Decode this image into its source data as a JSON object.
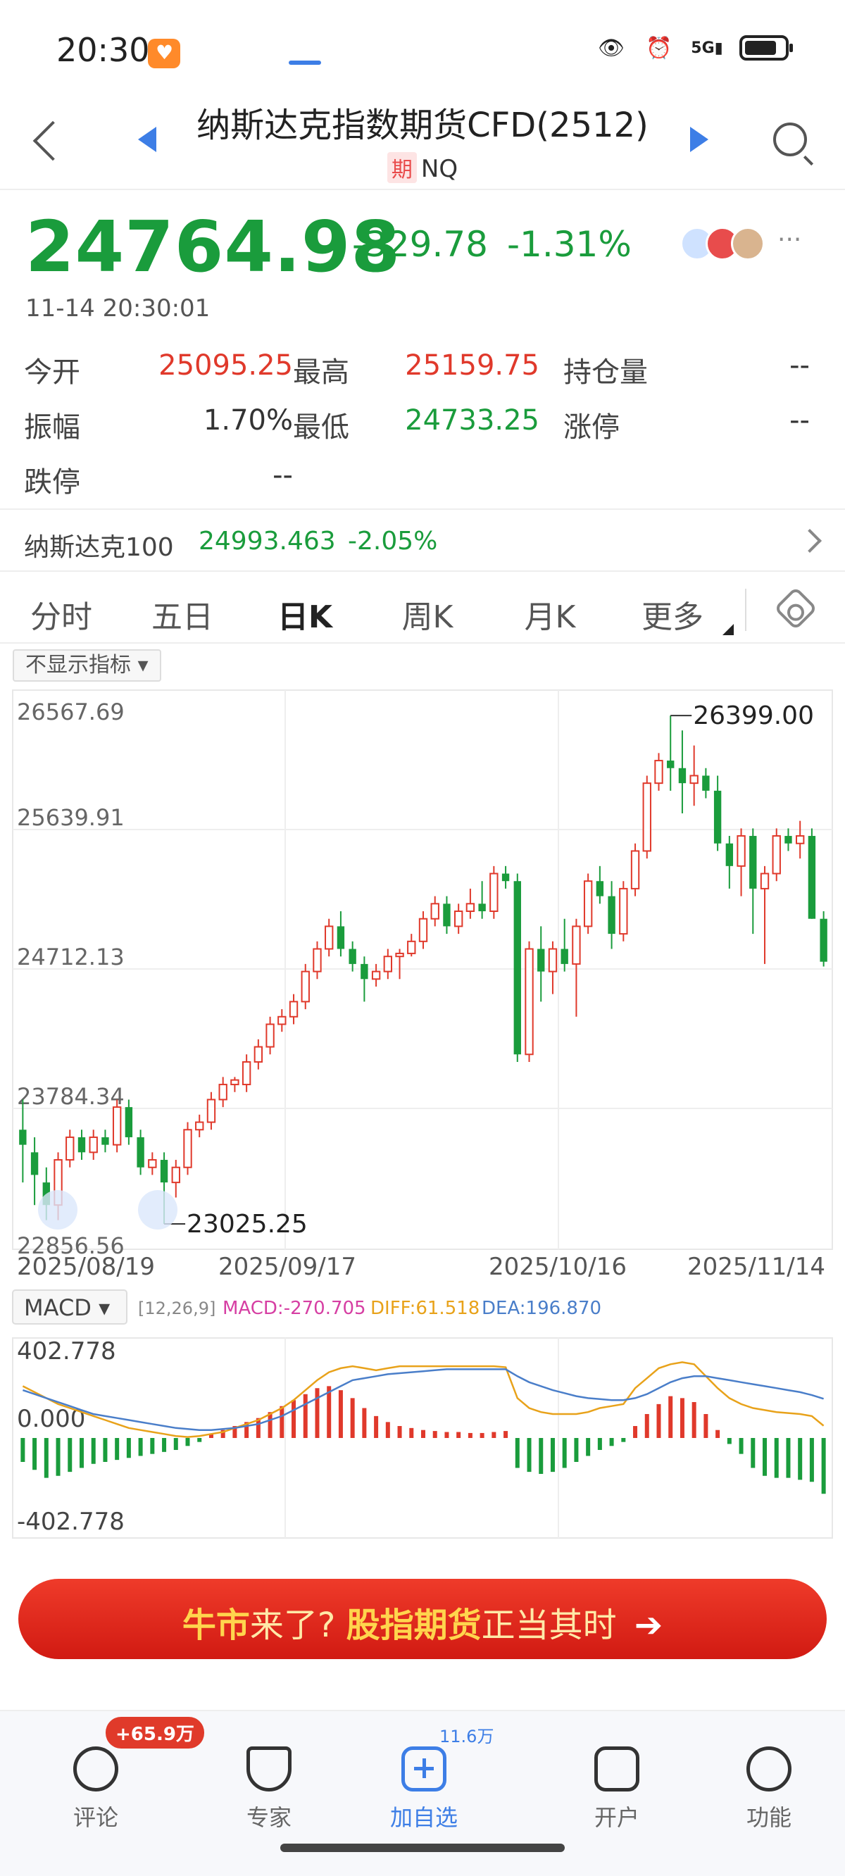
{
  "status_bar": {
    "time": "20:30",
    "icons": [
      "eye-icon",
      "alarm-icon",
      "signal-5g-icon",
      "battery-icon"
    ],
    "network": "5G"
  },
  "header": {
    "title": "纳斯达克指数期货CFD(2512)",
    "tag": "期",
    "code": "NQ"
  },
  "quote": {
    "price": "24764.98",
    "change": "-329.78",
    "change_pct": "-1.31%",
    "timestamp": "11-14 20:30:01",
    "more": "···",
    "fields": [
      {
        "label": "今开",
        "value": "25095.25",
        "color": "#e0392b"
      },
      {
        "label": "最高",
        "value": "25159.75",
        "color": "#e0392b"
      },
      {
        "label": "持仓量",
        "value": "--",
        "color": "#333333"
      },
      {
        "label": "振幅",
        "value": "1.70%",
        "color": "#333333"
      },
      {
        "label": "最低",
        "value": "24733.25",
        "color": "#1a9c3c"
      },
      {
        "label": "涨停",
        "value": "--",
        "color": "#333333"
      },
      {
        "label": "跌停",
        "value": "--",
        "color": "#333333"
      }
    ]
  },
  "index_row": {
    "name": "纳斯达克100",
    "value": "24993.463",
    "change_pct": "-2.05%"
  },
  "tabs": [
    "分时",
    "五日",
    "日K",
    "周K",
    "月K",
    "更多"
  ],
  "active_tab": "日K",
  "indicator_pill": "不显示指标 ▾",
  "chart_data": [
    {
      "type": "candlestick",
      "y_ticks": [
        "26567.69",
        "25639.91",
        "24712.13",
        "23784.34",
        "22856.56"
      ],
      "ylim": [
        22856.56,
        26567.69
      ],
      "x_ticks": [
        "2025/08/19",
        "2025/09/17",
        "2025/10/16",
        "2025/11/14"
      ],
      "annotations": {
        "high": "26399.00",
        "low": "23025.25"
      },
      "up_color": "#e0392b",
      "down_color": "#1a9c3c",
      "candles": [
        [
          23650,
          23850,
          23300,
          23550
        ],
        [
          23500,
          23600,
          23150,
          23350
        ],
        [
          23300,
          23400,
          23050,
          23150
        ],
        [
          23150,
          23500,
          23050,
          23450
        ],
        [
          23450,
          23650,
          23400,
          23600
        ],
        [
          23600,
          23650,
          23450,
          23500
        ],
        [
          23500,
          23650,
          23450,
          23600
        ],
        [
          23600,
          23650,
          23500,
          23550
        ],
        [
          23550,
          23850,
          23500,
          23800
        ],
        [
          23800,
          23850,
          23550,
          23600
        ],
        [
          23600,
          23650,
          23350,
          23400
        ],
        [
          23400,
          23500,
          23350,
          23450
        ],
        [
          23450,
          23500,
          23025,
          23300
        ],
        [
          23300,
          23450,
          23200,
          23400
        ],
        [
          23400,
          23700,
          23350,
          23650
        ],
        [
          23650,
          23750,
          23600,
          23700
        ],
        [
          23700,
          23900,
          23650,
          23850
        ],
        [
          23850,
          24000,
          23800,
          23950
        ],
        [
          23950,
          24000,
          23900,
          23980
        ],
        [
          23950,
          24150,
          23900,
          24100
        ],
        [
          24100,
          24250,
          24050,
          24200
        ],
        [
          24200,
          24400,
          24150,
          24350
        ],
        [
          24350,
          24450,
          24300,
          24400
        ],
        [
          24400,
          24550,
          24350,
          24500
        ],
        [
          24500,
          24750,
          24450,
          24700
        ],
        [
          24700,
          24900,
          24650,
          24850
        ],
        [
          24850,
          25050,
          24800,
          25000
        ],
        [
          25000,
          25100,
          24800,
          24850
        ],
        [
          24850,
          24900,
          24700,
          24750
        ],
        [
          24750,
          24800,
          24500,
          24650
        ],
        [
          24650,
          24750,
          24600,
          24700
        ],
        [
          24700,
          24850,
          24650,
          24800
        ],
        [
          24800,
          24850,
          24650,
          24820
        ],
        [
          24820,
          24950,
          24800,
          24900
        ],
        [
          24900,
          25100,
          24850,
          25050
        ],
        [
          25050,
          25200,
          25000,
          25150
        ],
        [
          25150,
          25200,
          24950,
          25000
        ],
        [
          25000,
          25150,
          24950,
          25100
        ],
        [
          25100,
          25250,
          25050,
          25150
        ],
        [
          25150,
          25300,
          25050,
          25100
        ],
        [
          25100,
          25400,
          25050,
          25350
        ],
        [
          25350,
          25400,
          25250,
          25300
        ],
        [
          25300,
          25350,
          24100,
          24150
        ],
        [
          24150,
          24900,
          24100,
          24850
        ],
        [
          24850,
          25000,
          24500,
          24700
        ],
        [
          24700,
          24900,
          24550,
          24850
        ],
        [
          24850,
          25050,
          24700,
          24750
        ],
        [
          24750,
          25050,
          24400,
          25000
        ],
        [
          25000,
          25350,
          24950,
          25300
        ],
        [
          25300,
          25400,
          25150,
          25200
        ],
        [
          25200,
          25300,
          24850,
          24950
        ],
        [
          24950,
          25300,
          24900,
          25250
        ],
        [
          25250,
          25550,
          25200,
          25500
        ],
        [
          25500,
          26000,
          25450,
          25950
        ],
        [
          25950,
          26150,
          25900,
          26100
        ],
        [
          26100,
          26399,
          25900,
          26050
        ],
        [
          26050,
          26300,
          25750,
          25950
        ],
        [
          25950,
          26200,
          25800,
          26000
        ],
        [
          26000,
          26050,
          25850,
          25900
        ],
        [
          25900,
          26000,
          25500,
          25550
        ],
        [
          25550,
          25600,
          25250,
          25400
        ],
        [
          25400,
          25650,
          25200,
          25600
        ],
        [
          25600,
          25650,
          24950,
          25250
        ],
        [
          25250,
          25400,
          24750,
          25350
        ],
        [
          25350,
          25650,
          25300,
          25600
        ],
        [
          25600,
          25650,
          25500,
          25550
        ],
        [
          25550,
          25700,
          25450,
          25600
        ],
        [
          25600,
          25650,
          25050,
          25050
        ],
        [
          25050,
          25100,
          24733.25,
          24764.98
        ]
      ]
    },
    {
      "type": "macd",
      "label": "MACD ▾",
      "params": "[12,26,9]",
      "macd_text": "MACD:-270.705",
      "diff_text": "DIFF:61.518",
      "dea_text": "DEA:196.870",
      "macd_color": "#d63fa3",
      "diff_color": "#e8a21a",
      "dea_color": "#4a7ec9",
      "y_ticks": [
        "402.778",
        "0.000",
        "-402.778"
      ],
      "ylim": [
        -402.778,
        402.778
      ],
      "hist": [
        -120,
        -160,
        -200,
        -190,
        -170,
        -150,
        -130,
        -120,
        -110,
        -100,
        -90,
        -80,
        -70,
        -60,
        -40,
        -20,
        20,
        40,
        60,
        80,
        100,
        130,
        160,
        190,
        220,
        250,
        260,
        240,
        200,
        150,
        110,
        80,
        60,
        50,
        40,
        35,
        30,
        30,
        25,
        25,
        30,
        35,
        -150,
        -170,
        -180,
        -170,
        -150,
        -120,
        -90,
        -60,
        -40,
        -20,
        60,
        120,
        170,
        210,
        200,
        180,
        120,
        40,
        -30,
        -80,
        -150,
        -190,
        -200,
        -200,
        -210,
        -220,
        -280
      ],
      "diff": [
        260,
        230,
        200,
        170,
        150,
        130,
        110,
        90,
        70,
        50,
        40,
        30,
        20,
        10,
        5,
        10,
        20,
        30,
        50,
        70,
        90,
        120,
        150,
        190,
        240,
        290,
        330,
        350,
        360,
        350,
        340,
        350,
        360,
        360,
        360,
        360,
        360,
        360,
        360,
        360,
        360,
        355,
        200,
        150,
        130,
        120,
        120,
        120,
        130,
        150,
        160,
        170,
        250,
        300,
        350,
        370,
        380,
        370,
        310,
        250,
        200,
        170,
        150,
        140,
        130,
        125,
        120,
        110,
        61.5
      ],
      "dea": [
        240,
        220,
        200,
        180,
        160,
        140,
        120,
        110,
        100,
        90,
        80,
        70,
        60,
        50,
        45,
        40,
        40,
        45,
        50,
        60,
        70,
        90,
        110,
        140,
        170,
        200,
        230,
        260,
        290,
        300,
        310,
        320,
        325,
        330,
        335,
        340,
        345,
        345,
        345,
        345,
        345,
        345,
        310,
        280,
        260,
        240,
        225,
        210,
        200,
        195,
        190,
        190,
        200,
        220,
        250,
        280,
        300,
        310,
        310,
        300,
        290,
        280,
        270,
        260,
        250,
        240,
        230,
        215,
        196.9
      ]
    }
  ],
  "banner": {
    "part1": "牛市",
    "part2": "来了?",
    "part3": "股指期货",
    "part4": "正当其时",
    "arrow": "➔"
  },
  "bottom_nav": {
    "items": [
      {
        "label": "评论",
        "icon": "comment-icon"
      },
      {
        "label": "专家",
        "icon": "expert-icon"
      },
      {
        "label": "加自选",
        "icon": "add-watchlist-icon"
      },
      {
        "label": "开户",
        "icon": "open-account-icon"
      },
      {
        "label": "功能",
        "icon": "menu-icon"
      }
    ],
    "comment_badge": "+65.9万",
    "watchlist_count": "11.6万"
  }
}
